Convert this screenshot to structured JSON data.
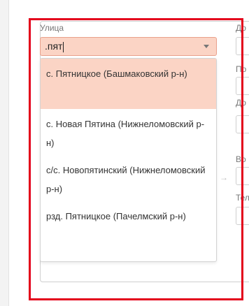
{
  "street": {
    "label": "Улица",
    "input_value": ".пят",
    "options": [
      {
        "text": "с. Пятницкое (Башмаковский р-н)"
      },
      {
        "text": "с. Новая Пятина (Нижнеломовский р-н)"
      },
      {
        "text": "с/с. Новопятинский (Нижнеломовский р-н)"
      },
      {
        "text": "рзд. Пятницкое (Пачелмский р-н)"
      }
    ]
  },
  "right_column": {
    "label_1": "До",
    "label_2": "По",
    "label_3": "До",
    "label_4": "Во",
    "label_5": "Тел"
  },
  "colors": {
    "highlight_border": "#e3001b",
    "active_option_bg": "#fbd4c5"
  },
  "icons": {
    "dropdown_arrow": "chevron-down-icon",
    "transfer_arrow": "arrow-right-icon"
  }
}
